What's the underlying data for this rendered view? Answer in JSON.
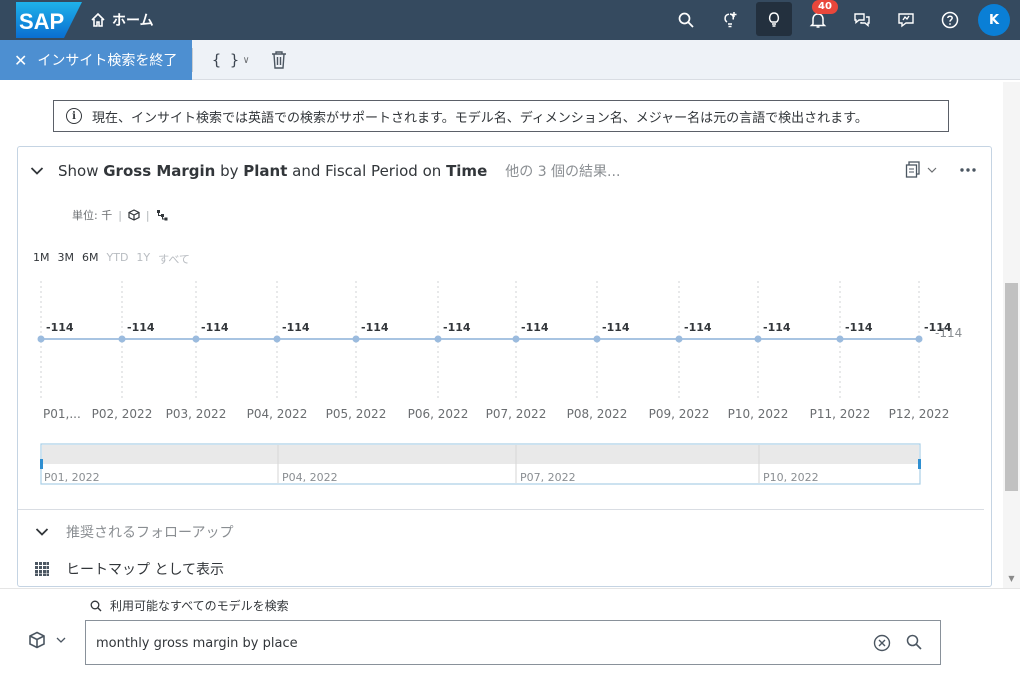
{
  "shell": {
    "logo": "SAP",
    "home_label": "ホーム",
    "notification_count": "40",
    "avatar_initial": "K"
  },
  "toolbar": {
    "exit_label": "インサイト検索を終了",
    "braces_label": "{ }"
  },
  "notice": {
    "text": "現在、インサイト検索では英語での検索がサポートされます。モデル名、ディメンション名、メジャー名は元の言語で検出されます。"
  },
  "card": {
    "title_parts": [
      "Show ",
      "Gross Margin",
      " by ",
      "Plant",
      " and Fiscal Period on ",
      "Time"
    ],
    "more_results": "他の 3 個の結果...",
    "unit": "単位: 千",
    "ranges": [
      {
        "label": "1M",
        "enabled": true
      },
      {
        "label": "3M",
        "enabled": true
      },
      {
        "label": "6M",
        "enabled": true
      },
      {
        "label": "YTD",
        "enabled": false
      },
      {
        "label": "1Y",
        "enabled": false
      },
      {
        "label": "すべて",
        "enabled": false
      }
    ],
    "follow_up_label": "推奨されるフォローアップ",
    "heatmap_label": "ヒートマップ として表示"
  },
  "chart_data": {
    "type": "line",
    "x": [
      "P01,...",
      "P02, 2022",
      "P03, 2022",
      "P04, 2022",
      "P05, 2022",
      "P06, 2022",
      "P07, 2022",
      "P08, 2022",
      "P09, 2022",
      "P10, 2022",
      "P11, 2022",
      "P12, 2022"
    ],
    "values": [
      -114,
      -114,
      -114,
      -114,
      -114,
      -114,
      -114,
      -114,
      -114,
      -114,
      -114,
      -114
    ],
    "data_labels": [
      "-114",
      "-114",
      "-114",
      "-114",
      "-114",
      "-114",
      "-114",
      "-114",
      "-114",
      "-114",
      "-114",
      "-114"
    ],
    "y_tick_label": "-114",
    "navigator_labels": [
      "P01, 2022",
      "P04, 2022",
      "P07, 2022",
      "P10, 2022"
    ],
    "grid": "vertical-dashed",
    "color": "#9bbbde"
  },
  "bottom": {
    "search_all_label": "利用可能なすべてのモデルを検索",
    "query_value": "monthly gross margin by place"
  },
  "colors": {
    "shell": "#354a5f",
    "exit_button": "#4d8fd1",
    "badge": "#e9473b",
    "avatar": "#0a7fd6"
  }
}
